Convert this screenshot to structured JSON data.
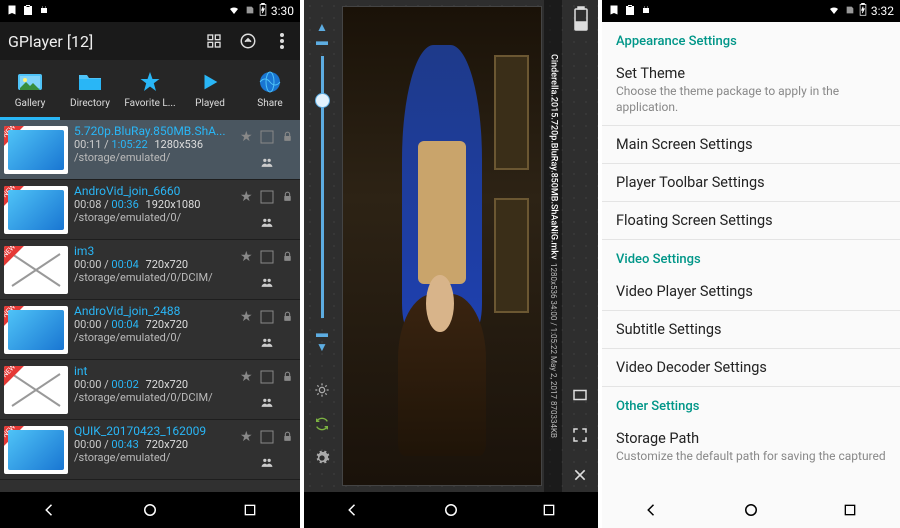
{
  "pane1": {
    "status": {
      "time": "3:30"
    },
    "appbar": {
      "title": "GPlayer [12]"
    },
    "tabs": [
      {
        "id": "gallery",
        "label": "Gallery"
      },
      {
        "id": "directory",
        "label": "Directory"
      },
      {
        "id": "favorite",
        "label": "Favorite L..."
      },
      {
        "id": "played",
        "label": "Played"
      },
      {
        "id": "share",
        "label": "Share"
      }
    ],
    "active_tab": "gallery",
    "items": [
      {
        "title": "5.720p.BluRay.850MB.ShA...",
        "pos": "00:11",
        "dur": "1:05:22",
        "res": "1280x536",
        "path": "/storage/emulated/",
        "selected": true
      },
      {
        "title": "AndroVid_join_6660",
        "pos": "00:08",
        "dur": "00:36",
        "res": "1920x1080",
        "path": "/storage/emulated/0/"
      },
      {
        "title": "im3",
        "pos": "00:00",
        "dur": "00:04",
        "res": "720x720",
        "path": "/storage/emulated/0/DCIM/"
      },
      {
        "title": "AndroVid_join_2488",
        "pos": "00:00",
        "dur": "00:04",
        "res": "720x720",
        "path": "/storage/emulated/0/"
      },
      {
        "title": "int",
        "pos": "00:00",
        "dur": "00:02",
        "res": "720x720",
        "path": "/storage/emulated/0/DCIM/"
      },
      {
        "title": "QUIK_20170423_162009",
        "pos": "00:00",
        "dur": "00:43",
        "res": "720x720",
        "path": "/storage/emulated/"
      }
    ]
  },
  "pane2": {
    "filename": "Cinderella.2015.720p.BluRay.850MB.ShAaNiG.mkv",
    "meta": "1280x536  34:00 / 1:05:22  May 2, 2017  870334KB"
  },
  "pane3": {
    "status": {
      "time": "3:32"
    },
    "sections": [
      {
        "header": "Appearance Settings",
        "items": [
          {
            "title": "Set Theme",
            "sub": "Choose the theme package to apply in the application."
          }
        ]
      },
      {
        "header": "",
        "items": [
          {
            "title": "Main Screen Settings"
          },
          {
            "title": "Player Toolbar Settings"
          },
          {
            "title": "Floating Screen Settings"
          }
        ]
      },
      {
        "header": "Video Settings",
        "items": [
          {
            "title": "Video Player Settings"
          },
          {
            "title": "Subtitle Settings"
          },
          {
            "title": "Video Decoder Settings"
          }
        ]
      },
      {
        "header": "Other Settings",
        "items": [
          {
            "title": "Storage Path",
            "sub": "Customize the default path for saving the captured"
          }
        ]
      }
    ]
  }
}
